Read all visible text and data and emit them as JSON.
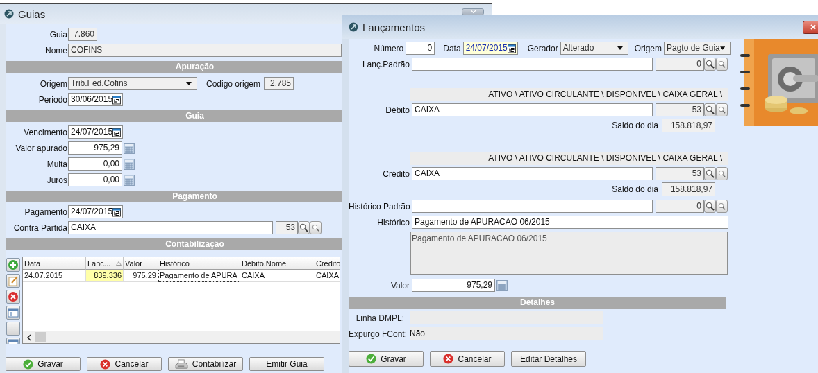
{
  "guias": {
    "title": "Guias",
    "guia": {
      "label": "Guia",
      "value": "7.860"
    },
    "nome": {
      "label": "Nome",
      "value": "COFINS"
    },
    "apuracao": {
      "heading": "Apuração",
      "origem": {
        "label": "Origem",
        "value": "Trib.Fed.Cofins"
      },
      "codigo_origem": {
        "label": "Codigo origem",
        "value": "2.785"
      },
      "periodo": {
        "label": "Periodo",
        "value": "30/06/2015"
      }
    },
    "guia_section": {
      "heading": "Guia",
      "vencimento": {
        "label": "Vencimento",
        "value": "24/07/2015"
      },
      "valores": [
        {
          "label": "Valor apurado",
          "value": "975,29"
        },
        {
          "label": "Multa",
          "value": "0,00"
        },
        {
          "label": "Juros",
          "value": "0,00"
        }
      ]
    },
    "pagamento": {
      "heading": "Pagamento",
      "data": {
        "label": "Pagamento",
        "value": "24/07/2015"
      },
      "contra_partida": {
        "label": "Contra Partida",
        "value": "CAIXA",
        "code": "53"
      }
    },
    "contabilizacao": {
      "heading": "Contabilização",
      "columns": [
        {
          "label": "Data",
          "sorted": false
        },
        {
          "label": "Lanc...",
          "sorted": true
        },
        {
          "label": "Valor",
          "sorted": false
        },
        {
          "label": "Histórico",
          "sorted": false
        },
        {
          "label": "Débito.Nome",
          "sorted": false
        },
        {
          "label": "Crédito",
          "sorted": false
        }
      ],
      "rows": [
        {
          "cells": [
            {
              "text": "24.07.2015",
              "focused": false
            },
            {
              "text": "839.336",
              "focused": false
            },
            {
              "text": "975,29",
              "focused": false
            },
            {
              "text": "Pagamento de APURA",
              "focused": true
            },
            {
              "text": "CAIXA",
              "focused": false
            },
            {
              "text": "CAIXA",
              "focused": false
            }
          ]
        }
      ]
    },
    "buttons": [
      {
        "label": "Gravar",
        "kind": "confirm"
      },
      {
        "label": "Cancelar",
        "kind": "cancel"
      },
      {
        "label": "Contabilizar",
        "kind": "post"
      },
      {
        "label": "Emitir Guia",
        "kind": "plain"
      }
    ]
  },
  "lancamentos": {
    "title": "Lançamentos",
    "numero": {
      "label": "Número",
      "value": "0"
    },
    "data": {
      "label": "Data",
      "value": "24/07/2015",
      "focused": true
    },
    "gerador": {
      "label": "Gerador",
      "value": "Alterado"
    },
    "origem": {
      "label": "Origem",
      "value": "Pagto de Guia"
    },
    "lanc_padrao": {
      "label": "Lanç.Padrão",
      "code": "0"
    },
    "contas": [
      {
        "path": "ATIVO \\ ATIVO CIRCULANTE \\ DISPONIVEL \\ CAIXA GERAL \\",
        "label": "Débito",
        "value": "CAIXA",
        "code": "53",
        "saldo_label": "Saldo do dia",
        "saldo": "158.818,97"
      },
      {
        "path": "ATIVO \\ ATIVO CIRCULANTE \\ DISPONIVEL \\ CAIXA GERAL \\",
        "label": "Crédito",
        "value": "CAIXA",
        "code": "53",
        "saldo_label": "Saldo do dia",
        "saldo": "158.818,97"
      }
    ],
    "historico_padrao": {
      "label": "Histórico Padrão",
      "code": "0"
    },
    "historico": {
      "label": "Histórico",
      "value": "Pagamento de APURACAO 06/2015",
      "memo": "Pagamento de APURACAO 06/2015"
    },
    "valor": {
      "label": "Valor",
      "value": "975,29"
    },
    "detalhes": {
      "heading": "Detalhes",
      "linha_dmpl": {
        "label": "Linha DMPL:"
      },
      "expurgo": {
        "label": "Expurgo FCont:",
        "value": "Não"
      }
    },
    "buttons": [
      {
        "label": "Gravar",
        "kind": "confirm"
      },
      {
        "label": "Cancelar",
        "kind": "cancel"
      },
      {
        "label": "Editar Detalhes",
        "kind": "plain"
      }
    ]
  }
}
